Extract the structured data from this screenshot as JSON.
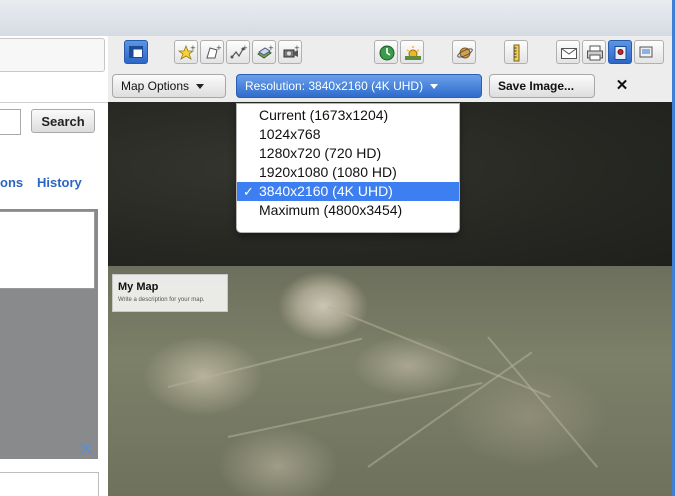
{
  "sidebar": {
    "search_label": "Search",
    "tab_partial": "ons",
    "tab_history": "History",
    "close_glyph": "✕"
  },
  "toolbar": {
    "icons": [
      "layout-panel-icon",
      "add-placemark-icon",
      "add-polygon-icon",
      "add-path-icon",
      "add-overlay-icon",
      "record-tour-icon",
      "historical-imagery-icon",
      "sun-icon",
      "planets-icon",
      "ruler-icon",
      "email-icon",
      "print-icon",
      "view-in-maps-icon"
    ],
    "map_options_label": "Map Options",
    "resolution_label": "Resolution: 3840x2160 (4K UHD)",
    "save_image_label": "Save Image...",
    "close_glyph": "✕"
  },
  "resolution_menu": {
    "options": [
      "Current (1673x1204)",
      "1024x768",
      "1280x720 (720 HD)",
      "1920x1080 (1080 HD)",
      "3840x2160 (4K UHD)",
      "Maximum (4800x3454)"
    ],
    "selected_index": 4,
    "check_glyph": "✓"
  },
  "map": {
    "legend_title": "My Map",
    "legend_description": "Write a description for your map."
  },
  "colors": {
    "accent": "#3d7ef0",
    "link": "#2b66c4"
  }
}
